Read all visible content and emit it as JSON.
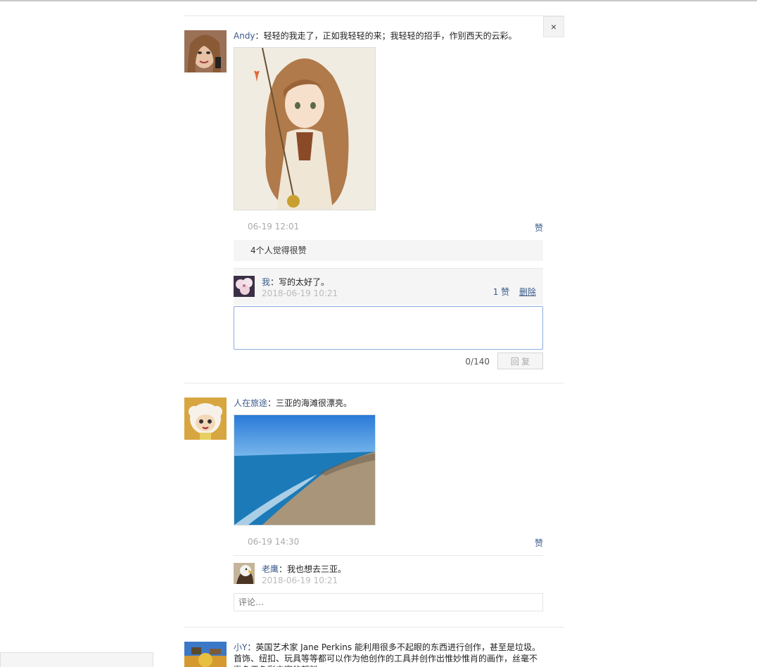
{
  "close_label": "×",
  "colors": {
    "link": "#3a5a8c",
    "muted": "#aaaaaa",
    "panel": "#f5f5f5"
  },
  "posts": [
    {
      "author": "Andy",
      "separator": "：",
      "content": "轻轻的我走了，正如我轻轻的来；我轻轻的招手，作别西天的云彩。",
      "time": "06-19 12:01",
      "like_label": "赞",
      "likes_summary": "4个人觉得很赞",
      "comments": [
        {
          "author": "我",
          "separator": "：",
          "text": "写的太好了。",
          "time": "2018-06-19 10:21",
          "likes": "1 赞",
          "delete_label": "删除"
        }
      ],
      "reply": {
        "value": "",
        "counter": "0/140",
        "button": "回 复"
      }
    },
    {
      "author": "人在旅途",
      "separator": "：",
      "content": "三亚的海滩很漂亮。",
      "time": "06-19 14:30",
      "like_label": "赞",
      "comments": [
        {
          "author": "老鹰",
          "separator": "：",
          "text": "我也想去三亚。",
          "time": "2018-06-19 10:21"
        }
      ],
      "comment_placeholder": "评论…"
    },
    {
      "author": "小Y",
      "separator": "：",
      "content": "英国艺术家 Jane Perkins 能利用很多不起眼的东西进行创作，甚至是垃圾。首饰、纽扣、玩具等等都可以作为他创作的工具并创作出惟妙惟肖的画作，丝毫不逊色于色彩丰富的颜料。"
    }
  ]
}
